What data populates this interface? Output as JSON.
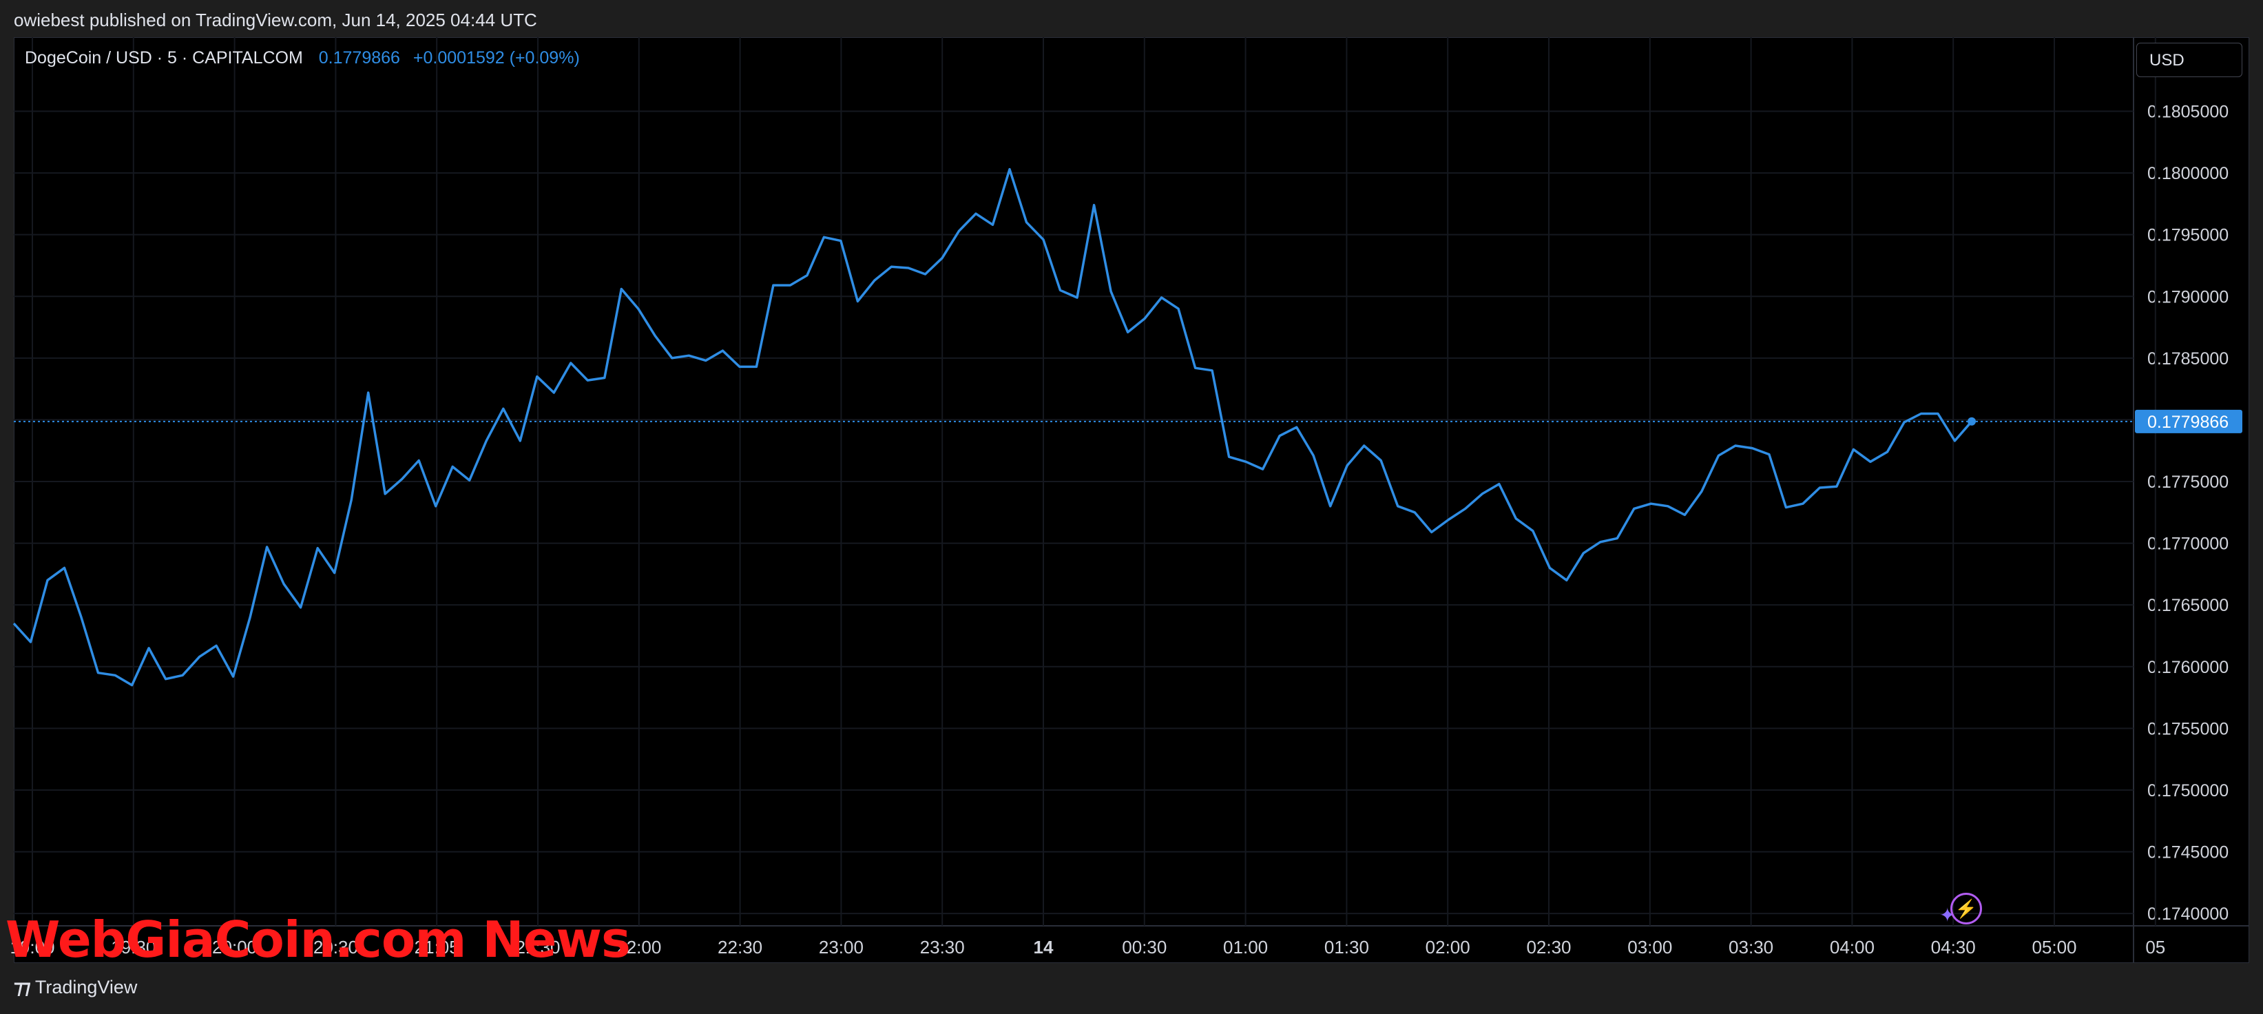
{
  "header": {
    "published": "owiebest published on TradingView.com, Jun 14, 2025 04:44 UTC"
  },
  "legend": {
    "symbol": "DogeCoin / USD · 5 · CAPITALCOM",
    "price": "0.1779866",
    "change": "+0.0001592 (+0.09%)"
  },
  "currency_label": "USD",
  "footer": {
    "logo_text": "TradingView"
  },
  "watermark": "WebGiaCoin.com News",
  "colors": {
    "line": "#2f8de4",
    "background": "#000000",
    "grid": "#15181f",
    "price_tag": "#2f8de4"
  },
  "icons": {
    "bolt": "lightning-bolt-icon",
    "sparkle": "sparkle-icon"
  },
  "chart_data": {
    "type": "line",
    "symbol": "DogeCoin / USD",
    "interval": "5",
    "exchange": "CAPITALCOM",
    "ylim": [
      0.1739,
      0.1811
    ],
    "y_ticks": [
      "0.1805000",
      "0.1800000",
      "0.1795000",
      "0.1790000",
      "0.1785000",
      "0.1780000",
      "0.1775000",
      "0.1770000",
      "0.1765000",
      "0.1760000",
      "0.1755000",
      "0.1750000",
      "0.1745000",
      "0.1740000"
    ],
    "x_ticks": [
      "19:00",
      "19:30",
      "20:00",
      "20:30",
      "21:05",
      "21:30",
      "22:00",
      "22:30",
      "23:00",
      "23:30",
      "14",
      "00:30",
      "01:00",
      "01:30",
      "02:00",
      "02:30",
      "03:00",
      "03:30",
      "04:00",
      "04:30",
      "05:00",
      "05"
    ],
    "x_ticks_bold": [
      "14"
    ],
    "last_price": 0.1779866,
    "last_price_label": "0.1779866",
    "grid": true,
    "values": [
      0.17635,
      0.1762,
      0.1767,
      0.1768,
      0.1764,
      0.17595,
      0.17593,
      0.17585,
      0.17615,
      0.1759,
      0.17593,
      0.17608,
      0.17617,
      0.17592,
      0.1764,
      0.17697,
      0.17667,
      0.17648,
      0.17696,
      0.17676,
      0.17735,
      0.17822,
      0.1774,
      0.17752,
      0.17767,
      0.1773,
      0.17762,
      0.17751,
      0.17783,
      0.17809,
      0.17783,
      0.17835,
      0.17822,
      0.17846,
      0.17832,
      0.17834,
      0.17906,
      0.1789,
      0.17868,
      0.1785,
      0.17852,
      0.17848,
      0.17856,
      0.17843,
      0.17843,
      0.17909,
      0.17909,
      0.17917,
      0.17948,
      0.17945,
      0.17896,
      0.17913,
      0.17924,
      0.17923,
      0.17918,
      0.17931,
      0.17953,
      0.17967,
      0.17958,
      0.18003,
      0.1796,
      0.17946,
      0.17905,
      0.17899,
      0.17974,
      0.17904,
      0.17871,
      0.17882,
      0.17899,
      0.1789,
      0.17842,
      0.1784,
      0.1777,
      0.17766,
      0.1776,
      0.17787,
      0.17794,
      0.17771,
      0.1773,
      0.17763,
      0.17779,
      0.17767,
      0.1773,
      0.17725,
      0.17709,
      0.17719,
      0.17728,
      0.1774,
      0.17748,
      0.1772,
      0.1771,
      0.1768,
      0.1767,
      0.17692,
      0.17701,
      0.17704,
      0.17728,
      0.17732,
      0.1773,
      0.17723,
      0.17742,
      0.17771,
      0.17779,
      0.17777,
      0.17772,
      0.17729,
      0.17732,
      0.17745,
      0.17746,
      0.17776,
      0.17766,
      0.17774,
      0.17798,
      0.17805,
      0.17805,
      0.17783,
      0.177987
    ]
  }
}
